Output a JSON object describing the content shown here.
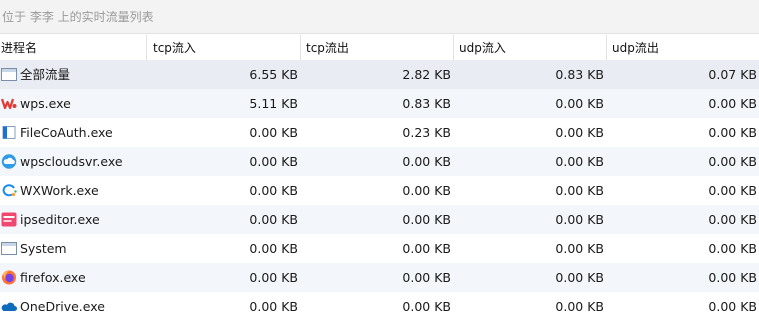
{
  "window": {
    "title": "位于 李李 上的实时流量列表"
  },
  "columns": [
    "进程名",
    "tcp流入",
    "tcp流出",
    "udp流入",
    "udp流出"
  ],
  "rows": [
    {
      "name": "全部流量",
      "icon": "window-icon",
      "tcp_in": "6.55 KB",
      "tcp_out": "2.82 KB",
      "udp_in": "0.83 KB",
      "udp_out": "0.07 KB"
    },
    {
      "name": "wps.exe",
      "icon": "wps-icon",
      "tcp_in": "5.11 KB",
      "tcp_out": "0.83 KB",
      "udp_in": "0.00 KB",
      "udp_out": "0.00 KB"
    },
    {
      "name": "FileCoAuth.exe",
      "icon": "filecoauth-icon",
      "tcp_in": "0.00 KB",
      "tcp_out": "0.23 KB",
      "udp_in": "0.00 KB",
      "udp_out": "0.00 KB"
    },
    {
      "name": "wpscloudsvr.exe",
      "icon": "cloud-icon",
      "tcp_in": "0.00 KB",
      "tcp_out": "0.00 KB",
      "udp_in": "0.00 KB",
      "udp_out": "0.00 KB"
    },
    {
      "name": "WXWork.exe",
      "icon": "wxwork-icon",
      "tcp_in": "0.00 KB",
      "tcp_out": "0.00 KB",
      "udp_in": "0.00 KB",
      "udp_out": "0.00 KB"
    },
    {
      "name": "ipseditor.exe",
      "icon": "ipseditor-icon",
      "tcp_in": "0.00 KB",
      "tcp_out": "0.00 KB",
      "udp_in": "0.00 KB",
      "udp_out": "0.00 KB"
    },
    {
      "name": "System",
      "icon": "window-icon",
      "tcp_in": "0.00 KB",
      "tcp_out": "0.00 KB",
      "udp_in": "0.00 KB",
      "udp_out": "0.00 KB"
    },
    {
      "name": "firefox.exe",
      "icon": "firefox-icon",
      "tcp_in": "0.00 KB",
      "tcp_out": "0.00 KB",
      "udp_in": "0.00 KB",
      "udp_out": "0.00 KB"
    },
    {
      "name": "OneDrive.exe",
      "icon": "onedrive-icon",
      "tcp_in": "0.00 KB",
      "tcp_out": "0.00 KB",
      "udp_in": "0.00 KB",
      "udp_out": "0.00 KB"
    }
  ]
}
